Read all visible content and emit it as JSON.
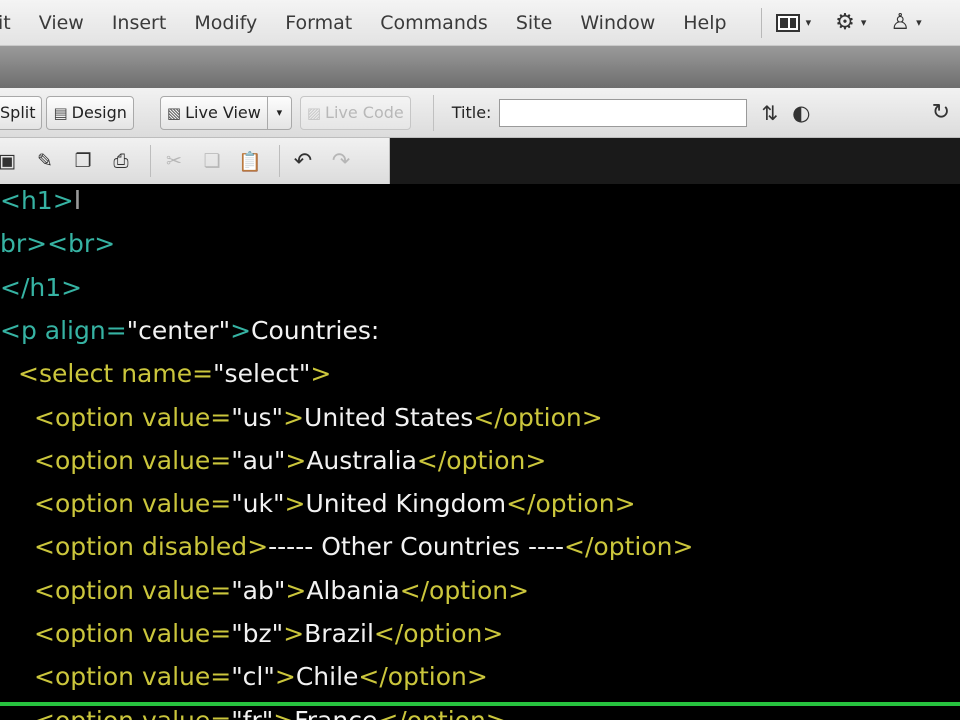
{
  "menu": {
    "items": [
      "it",
      "View",
      "Insert",
      "Modify",
      "Format",
      "Commands",
      "Site",
      "Window",
      "Help"
    ],
    "tools": [
      {
        "name": "layout-icon",
        "caret": "▾"
      },
      {
        "name": "gear-icon",
        "glyph": "⚙",
        "caret": "▾"
      },
      {
        "name": "workspace-icon",
        "glyph": "♙",
        "caret": "▾"
      }
    ]
  },
  "doc_toolbar": {
    "split_label": "Split",
    "design_label": "Design",
    "live_view_label": "Live View",
    "live_view_caret": "▾",
    "live_code_label": "Live Code",
    "title_label": "Title:",
    "title_value": "",
    "upload_glyph": "⇅",
    "globe_glyph": "◐",
    "refresh_glyph": "↻"
  },
  "std_toolbar": {
    "icons": [
      "save-icon",
      "save-all-icon",
      "copy-file-icon",
      "print-icon",
      "cut-icon",
      "copy-icon",
      "paste-icon",
      "undo-icon",
      "redo-icon"
    ]
  },
  "code": {
    "lines": [
      {
        "indent": 0,
        "parts": [
          [
            "tag",
            "<h1>"
          ]
        ]
      },
      {
        "indent": 0,
        "parts": [
          [
            "tag",
            "br><br>"
          ]
        ]
      },
      {
        "indent": 0,
        "parts": [
          [
            "tag",
            "</h1>"
          ]
        ]
      },
      {
        "indent": 0,
        "parts": [
          [
            "tag",
            "<p "
          ],
          [
            "attr",
            "align="
          ],
          [
            "str",
            "\"center\""
          ],
          [
            "tag",
            ">"
          ],
          [
            "txt",
            "Countries:"
          ]
        ]
      },
      {
        "indent": 1,
        "parts": [
          [
            "tag-opt",
            "<select "
          ],
          [
            "attr-opt",
            "name="
          ],
          [
            "str",
            "\"select\""
          ],
          [
            "tag-opt",
            ">"
          ]
        ]
      },
      {
        "indent": 2,
        "parts": [
          [
            "tag-opt",
            "<option "
          ],
          [
            "attr-opt",
            "value="
          ],
          [
            "str",
            "\"us\""
          ],
          [
            "tag-opt",
            ">"
          ],
          [
            "txt",
            "United States"
          ],
          [
            "tag-opt",
            "</option>"
          ]
        ]
      },
      {
        "indent": 2,
        "parts": [
          [
            "tag-opt",
            "<option "
          ],
          [
            "attr-opt",
            "value="
          ],
          [
            "str",
            "\"au\""
          ],
          [
            "tag-opt",
            ">"
          ],
          [
            "txt",
            "Australia"
          ],
          [
            "tag-opt",
            "</option>"
          ]
        ]
      },
      {
        "indent": 2,
        "parts": [
          [
            "tag-opt",
            "<option "
          ],
          [
            "attr-opt",
            "value="
          ],
          [
            "str",
            "\"uk\""
          ],
          [
            "tag-opt",
            ">"
          ],
          [
            "txt",
            "United Kingdom"
          ],
          [
            "tag-opt",
            "</option>"
          ]
        ]
      },
      {
        "indent": 2,
        "parts": [
          [
            "tag-opt",
            "<option "
          ],
          [
            "attr-opt",
            "disabled"
          ],
          [
            "tag-opt",
            ">"
          ],
          [
            "txt",
            "----- Other Countries ----"
          ],
          [
            "tag-opt",
            "</option>"
          ]
        ]
      },
      {
        "indent": 2,
        "parts": [
          [
            "tag-opt",
            "<option "
          ],
          [
            "attr-opt",
            "value="
          ],
          [
            "str",
            "\"ab\""
          ],
          [
            "tag-opt",
            ">"
          ],
          [
            "txt",
            "Albania"
          ],
          [
            "tag-opt",
            "</option>"
          ]
        ]
      },
      {
        "indent": 2,
        "parts": [
          [
            "tag-opt",
            "<option "
          ],
          [
            "attr-opt",
            "value="
          ],
          [
            "str",
            "\"bz\""
          ],
          [
            "tag-opt",
            ">"
          ],
          [
            "txt",
            "Brazil"
          ],
          [
            "tag-opt",
            "</option>"
          ]
        ]
      },
      {
        "indent": 2,
        "parts": [
          [
            "tag-opt",
            "<option "
          ],
          [
            "attr-opt",
            "value="
          ],
          [
            "str",
            "\"cl\""
          ],
          [
            "tag-opt",
            ">"
          ],
          [
            "txt",
            "Chile"
          ],
          [
            "tag-opt",
            "</option>"
          ]
        ]
      },
      {
        "indent": 2,
        "parts": [
          [
            "tag-opt",
            "<option "
          ],
          [
            "attr-opt",
            "value="
          ],
          [
            "str",
            "\"fr\""
          ],
          [
            "tag-opt",
            ">"
          ],
          [
            "txt",
            "France"
          ],
          [
            "tag-opt",
            "</option>"
          ]
        ]
      }
    ]
  },
  "colors": {
    "tag_teal": "#36b3a3",
    "tag_yellow": "#cbc63c",
    "text_white": "#f2f2f2",
    "current_line": "#27c23f"
  }
}
